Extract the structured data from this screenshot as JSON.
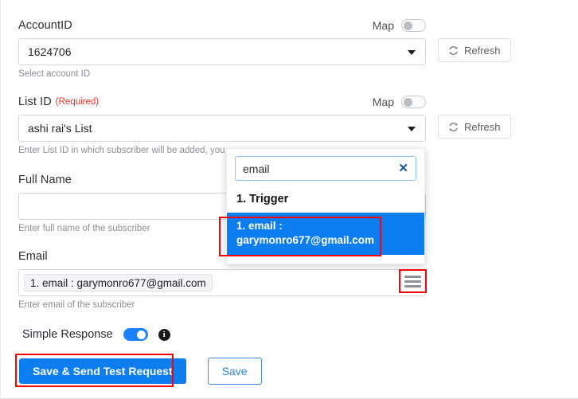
{
  "fields": {
    "account": {
      "label": "AccountID",
      "map_label": "Map",
      "map_on": false,
      "value": "1624706",
      "help": "Select account ID",
      "refresh_label": "Refresh"
    },
    "list": {
      "label": "List ID",
      "required_text": "(Required)",
      "map_label": "Map",
      "map_on": false,
      "value": "ashi rai's List",
      "help": "Enter List ID in which subscriber will be added, you",
      "refresh_label": "Refresh"
    },
    "full_name": {
      "label": "Full Name",
      "value": "",
      "placeholder": "",
      "help": "Enter full name of the subscriber"
    },
    "email": {
      "label": "Email",
      "chip_value": "1. email : garymonro677@gmail.com",
      "help": "Enter email of the subscriber"
    }
  },
  "dropdown": {
    "search_value": "email",
    "search_placeholder": "",
    "clear_icon": "✕",
    "group_label": "1. Trigger",
    "selected_item": "1. email : garymonro677@gmail.com"
  },
  "bottom": {
    "simple_response_label": "Simple Response",
    "simple_response_on": true,
    "info_icon": "i",
    "save_test_label": "Save & Send Test Request",
    "save_label": "Save"
  },
  "colors": {
    "accent": "#0c7ef0",
    "annotation": "#fb0007",
    "required": "#e8342a"
  }
}
